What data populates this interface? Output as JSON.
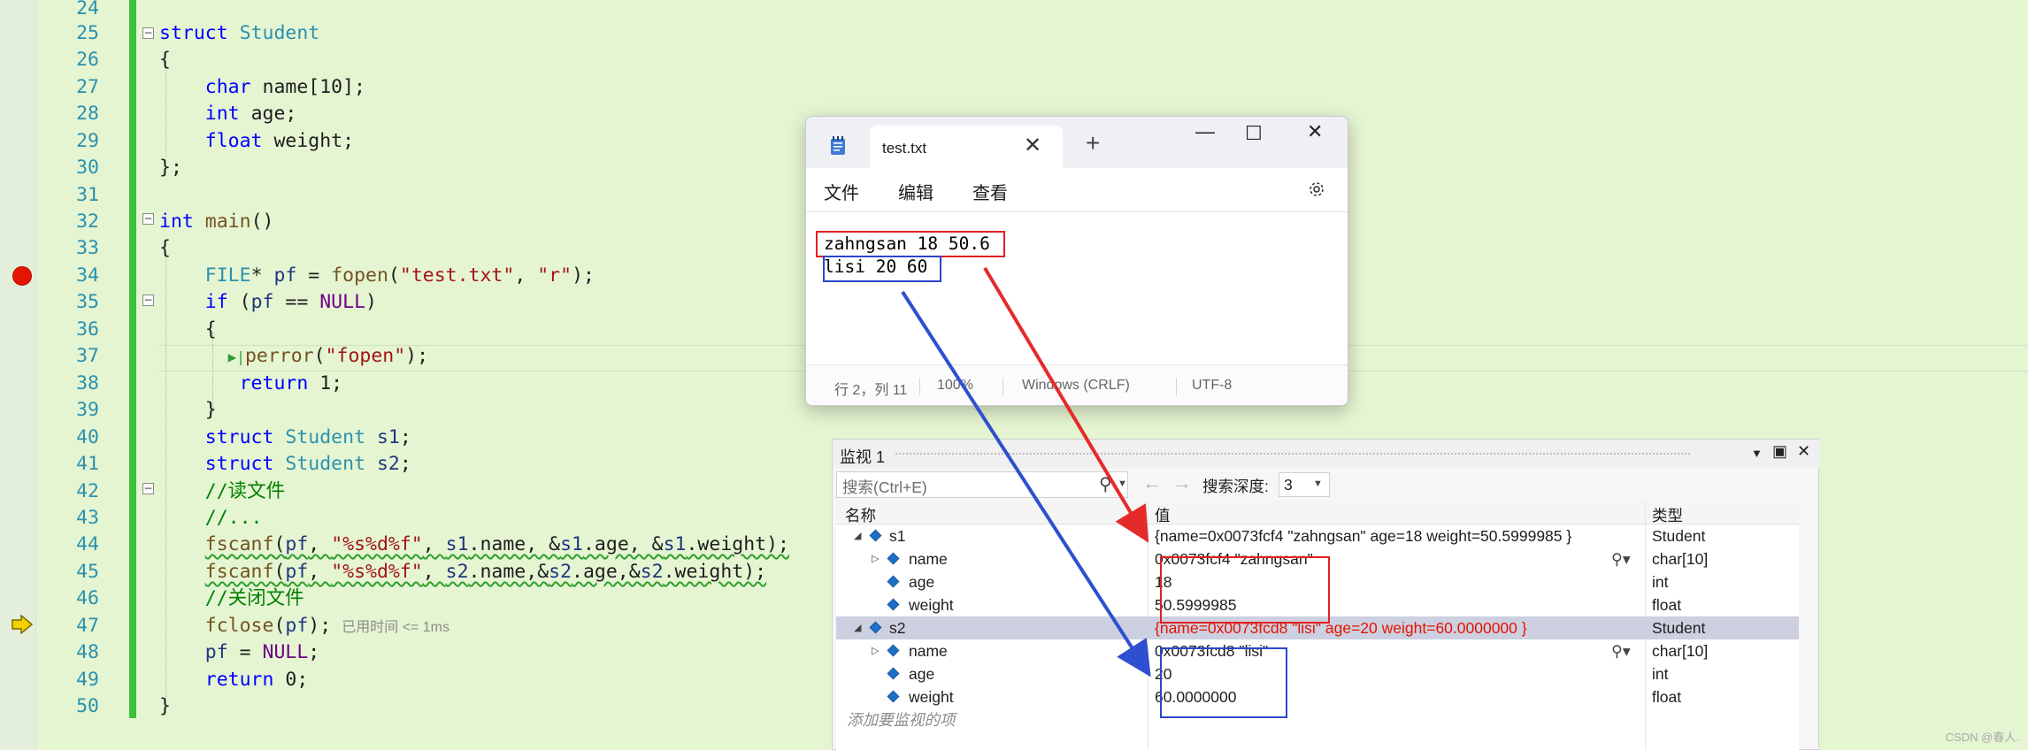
{
  "editor": {
    "lines": [
      {
        "n": "24"
      },
      {
        "n": "25"
      },
      {
        "n": "26"
      },
      {
        "n": "27"
      },
      {
        "n": "28"
      },
      {
        "n": "29"
      },
      {
        "n": "30"
      },
      {
        "n": "31"
      },
      {
        "n": "32"
      },
      {
        "n": "33"
      },
      {
        "n": "34"
      },
      {
        "n": "35"
      },
      {
        "n": "36"
      },
      {
        "n": "37"
      },
      {
        "n": "38"
      },
      {
        "n": "39"
      },
      {
        "n": "40"
      },
      {
        "n": "41"
      },
      {
        "n": "42"
      },
      {
        "n": "43"
      },
      {
        "n": "44"
      },
      {
        "n": "45"
      },
      {
        "n": "46"
      },
      {
        "n": "47"
      },
      {
        "n": "48"
      },
      {
        "n": "49"
      },
      {
        "n": "50"
      }
    ],
    "code": {
      "l25a": "struct",
      "l25b": "Student",
      "l26": "{",
      "l27a": "char",
      "l27b": " name[10];",
      "l28a": "int",
      "l28b": " age;",
      "l29a": "float",
      "l29b": " weight;",
      "l30": "};",
      "l32a": "int",
      "l32b": "main",
      "l32c": "()",
      "l33": "{",
      "l34a": "FILE",
      "l34b": "* ",
      "l34c": "pf",
      "l34d": " = ",
      "l34e": "fopen",
      "l34f": "(",
      "l34g": "\"test.txt\"",
      "l34h": ", ",
      "l34i": "\"r\"",
      "l34j": ");",
      "l35a": "if",
      "l35b": " (",
      "l35c": "pf",
      "l35d": " == ",
      "l35e": "NULL",
      "l35f": ")",
      "l36": "{",
      "l37a": "perror",
      "l37b": "(",
      "l37c": "\"fopen\"",
      "l37d": ");",
      "l38a": "return",
      "l38b": " 1;",
      "l39": "}",
      "l40a": "struct",
      "l40b": "Student",
      "l40c": "s1",
      "l40d": ";",
      "l41a": "struct",
      "l41b": "Student",
      "l41c": "s2",
      "l41d": ";",
      "l42": "//读文件",
      "l43": "//...",
      "l44a": "fscanf",
      "l44b": "(",
      "l44c": "pf",
      "l44d": ", ",
      "l44e": "\"%s%d%f\"",
      "l44f": ", ",
      "l44g": "s1",
      "l44h": ".name, &",
      "l44i": "s1",
      "l44j": ".age, &",
      "l44k": "s1",
      "l44l": ".weight);",
      "l45a": "fscanf",
      "l45b": "(",
      "l45c": "pf",
      "l45d": ", ",
      "l45e": "\"%s%d%f\"",
      "l45f": ", ",
      "l45g": "s2",
      "l45h": ".name,&",
      "l45i": "s2",
      "l45j": ".age,&",
      "l45k": "s2",
      "l45l": ".weight);",
      "l46": "//关闭文件",
      "l47a": "fclose",
      "l47b": "(",
      "l47c": "pf",
      "l47d": ");",
      "l47e": "已用时间 <= 1ms",
      "l48a": "pf",
      "l48b": " = ",
      "l48c": "NULL",
      "l48d": ";",
      "l49a": "return",
      "l49b": " 0;",
      "l50": "}"
    }
  },
  "notepad": {
    "tab_title": "test.txt",
    "tab_close": "✕",
    "new_tab": "+",
    "minimize": "—",
    "maximize": "☐",
    "close": "✕",
    "menu": {
      "file": "文件",
      "edit": "编辑",
      "view": "查看"
    },
    "content_line1": "zahngsan 18 50.6",
    "content_line2": "lisi 20 60",
    "status": {
      "position": "行 2，列 11",
      "zoom": "100%",
      "eol": "Windows (CRLF)",
      "encoding": "UTF-8"
    }
  },
  "watch": {
    "title": "监视 1",
    "search_placeholder": "搜索(Ctrl+E)",
    "depth_label": "搜索深度:",
    "depth_value": "3",
    "col_name": "名称",
    "col_value": "值",
    "col_type": "类型",
    "rows": [
      {
        "name": "s1",
        "value": "{name=0x0073fcf4 \"zahngsan\" age=18 weight=50.5999985 }",
        "type": "Student"
      },
      {
        "name": "name",
        "value": "0x0073fcf4 \"zahngsan\"",
        "type": "char[10]"
      },
      {
        "name": "age",
        "value": "18",
        "type": "int"
      },
      {
        "name": "weight",
        "value": "50.5999985",
        "type": "float"
      },
      {
        "name": "s2",
        "value": "{name=0x0073fcd8 \"lisi\" age=20 weight=60.0000000 }",
        "type": "Student"
      },
      {
        "name": "name",
        "value": "0x0073fcd8 \"lisi\"",
        "type": "char[10]"
      },
      {
        "name": "age",
        "value": "20",
        "type": "int"
      },
      {
        "name": "weight",
        "value": "60.0000000",
        "type": "float"
      }
    ],
    "add_item": "添加要监视的项"
  },
  "watermark": "CSDN @春人.",
  "colors": {
    "red_arrow": "#e52a2a",
    "blue_arrow": "#2f4fd1",
    "breakpoint": "#e51400",
    "change_bar": "#39c43b"
  }
}
